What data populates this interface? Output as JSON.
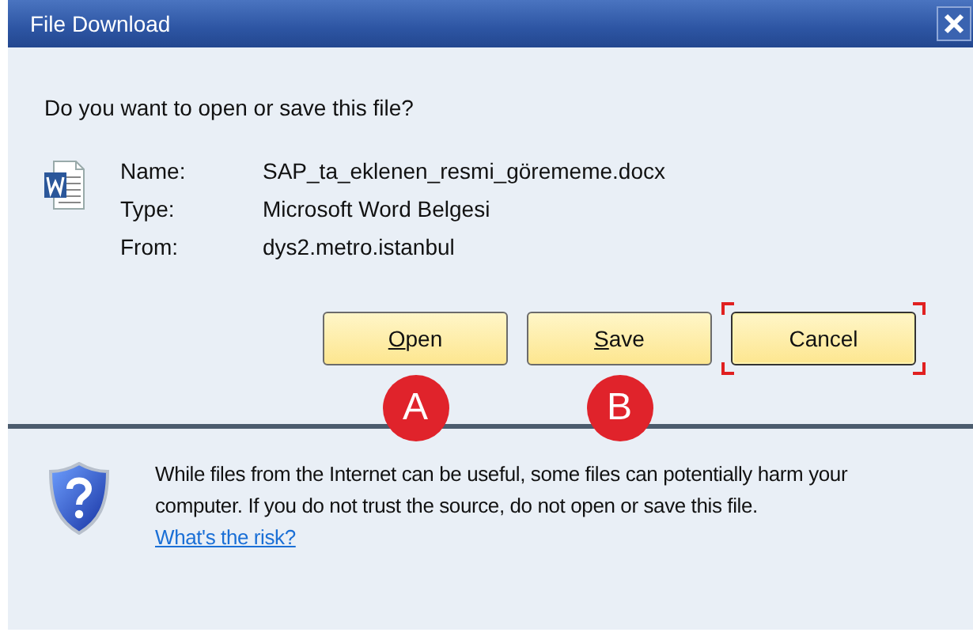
{
  "window": {
    "title": "File Download"
  },
  "question": "Do you want to open or save this file?",
  "file_info": [
    {
      "label": "Name:",
      "value": "SAP_ta_eklenen_resmi_görememe.docx"
    },
    {
      "label": "Type:",
      "value": "Microsoft Word Belgesi"
    },
    {
      "label": "From:",
      "value": "dys2.metro.istanbul"
    }
  ],
  "buttons": [
    {
      "mnemonic": "O",
      "label_rest": "pen",
      "focused": false,
      "marker": "A"
    },
    {
      "mnemonic": "S",
      "label_rest": "ave",
      "focused": false,
      "marker": "B"
    },
    {
      "label": "Cancel",
      "focused": true
    }
  ],
  "warning": {
    "text": "While files from the Internet can be useful, some files can potentially harm your computer. If you do not trust the source, do not open or save this file.",
    "link": "What's the risk?"
  }
}
